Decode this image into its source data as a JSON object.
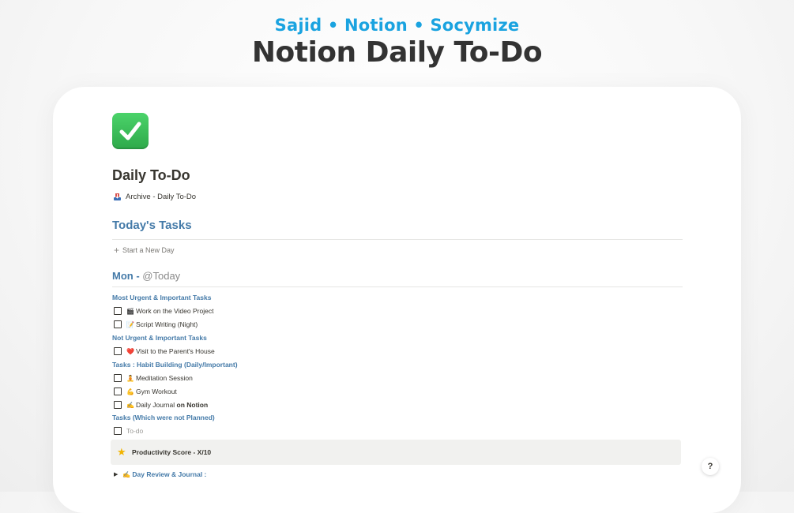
{
  "header": {
    "tagline": "Sajid • Notion • Socymize",
    "title": "Notion Daily To-Do"
  },
  "page": {
    "icon": "white-check-mark-icon",
    "title": "Daily To-Do",
    "archive_link": "Archive - Daily To-Do"
  },
  "todays_tasks": {
    "heading": "Today's Tasks",
    "new_day_button": "Start a New Day"
  },
  "day": {
    "name": "Mon",
    "separator": " - ",
    "mention": "@Today"
  },
  "sections": [
    {
      "label": "Most Urgent & Important Tasks",
      "tasks": [
        {
          "emoji": "🎬",
          "text": "Work on the Video Project",
          "checked": false
        },
        {
          "emoji": "📝",
          "text": "Script Writing (Night)",
          "checked": false
        }
      ]
    },
    {
      "label": "Not Urgent & Important Tasks",
      "tasks": [
        {
          "emoji": "❤️",
          "text": "Visit to the Parent's House",
          "checked": false
        }
      ]
    },
    {
      "label": "Tasks : Habit Building (Daily/Important)",
      "tasks": [
        {
          "emoji": "🧘",
          "text": "Meditation Session",
          "checked": false
        },
        {
          "emoji": "💪",
          "text": "Gym Workout",
          "checked": false
        },
        {
          "emoji": "✍️",
          "text": "Daily Journal",
          "text_bold": "on Notion",
          "checked": false
        }
      ]
    },
    {
      "label": "Tasks (Which were not Planned)",
      "tasks": [
        {
          "emoji": "",
          "text": "To-do",
          "placeholder": true,
          "checked": false
        }
      ]
    }
  ],
  "callout": {
    "icon": "star-icon",
    "text": "Productivity Score - X/10"
  },
  "toggle": {
    "emoji": "✍️",
    "text": "Day Review & Journal :"
  },
  "help_button": "?",
  "colors": {
    "tagline": "#1aa3e0",
    "heading_blue": "#447aa8",
    "checkbox_green": "#3ccf5e",
    "callout_bg": "#f1f1ef"
  }
}
